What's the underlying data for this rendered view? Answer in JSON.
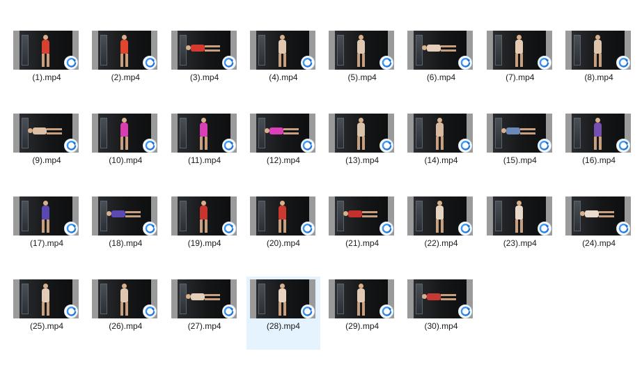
{
  "window": {
    "view": "large-icons",
    "selected_index": 27
  },
  "accent_color": "#e5f3ff",
  "files": [
    {
      "name": "(1).mp4",
      "pose": "standing",
      "suit": "#d8412f",
      "icon": "video-file-icon"
    },
    {
      "name": "(2).mp4",
      "pose": "standing",
      "suit": "#e0452e",
      "icon": "video-file-icon"
    },
    {
      "name": "(3).mp4",
      "pose": "lying",
      "suit": "#d63a2f",
      "icon": "video-file-icon"
    },
    {
      "name": "(4).mp4",
      "pose": "standing",
      "suit": "#e2c7b0",
      "icon": "video-file-icon"
    },
    {
      "name": "(5).mp4",
      "pose": "standing",
      "suit": "#e0c7b2",
      "icon": "video-file-icon"
    },
    {
      "name": "(6).mp4",
      "pose": "lying",
      "suit": "#e6d0bd",
      "icon": "video-file-icon"
    },
    {
      "name": "(7).mp4",
      "pose": "standing",
      "suit": "#e4cbb4",
      "icon": "video-file-icon"
    },
    {
      "name": "(8).mp4",
      "pose": "standing",
      "suit": "#dfc4ad",
      "icon": "video-file-icon"
    },
    {
      "name": "(9).mp4",
      "pose": "lying",
      "suit": "#dbc0a5",
      "icon": "video-file-icon"
    },
    {
      "name": "(10).mp4",
      "pose": "standing",
      "suit": "#d83db2",
      "icon": "video-file-icon"
    },
    {
      "name": "(11).mp4",
      "pose": "standing",
      "suit": "#da3fb5",
      "icon": "video-file-icon"
    },
    {
      "name": "(12).mp4",
      "pose": "lying",
      "suit": "#dc40b8",
      "icon": "video-file-icon"
    },
    {
      "name": "(13).mp4",
      "pose": "standing",
      "suit": "#d9c2aa",
      "icon": "video-file-icon"
    },
    {
      "name": "(14).mp4",
      "pose": "standing",
      "suit": "#d7b9a0",
      "icon": "video-file-icon"
    },
    {
      "name": "(15).mp4",
      "pose": "lying",
      "suit": "#6a88b8",
      "icon": "video-file-icon"
    },
    {
      "name": "(16).mp4",
      "pose": "standing",
      "suit": "#7650b0",
      "icon": "video-file-icon"
    },
    {
      "name": "(17).mp4",
      "pose": "standing",
      "suit": "#5a47b0",
      "icon": "video-file-icon"
    },
    {
      "name": "(18).mp4",
      "pose": "lying",
      "suit": "#5c49b2",
      "icon": "video-file-icon"
    },
    {
      "name": "(19).mp4",
      "pose": "standing",
      "suit": "#c9352e",
      "icon": "video-file-icon"
    },
    {
      "name": "(20).mp4",
      "pose": "standing",
      "suit": "#cc3a2f",
      "icon": "video-file-icon"
    },
    {
      "name": "(21).mp4",
      "pose": "lying",
      "suit": "#c4302b",
      "icon": "video-file-icon"
    },
    {
      "name": "(22).mp4",
      "pose": "standing",
      "suit": "#e6d4c3",
      "icon": "video-file-icon"
    },
    {
      "name": "(23).mp4",
      "pose": "standing",
      "suit": "#e9d9ca",
      "icon": "video-file-icon"
    },
    {
      "name": "(24).mp4",
      "pose": "lying",
      "suit": "#eadbcd",
      "icon": "video-file-icon"
    },
    {
      "name": "(25).mp4",
      "pose": "standing",
      "suit": "#e2ccb8",
      "icon": "video-file-icon"
    },
    {
      "name": "(26).mp4",
      "pose": "standing",
      "suit": "#dfc6b0",
      "icon": "video-file-icon"
    },
    {
      "name": "(27).mp4",
      "pose": "lying",
      "suit": "#e4cfbb",
      "icon": "video-file-icon"
    },
    {
      "name": "(28).mp4",
      "pose": "standing",
      "suit": "#e8d4c1",
      "icon": "video-file-icon"
    },
    {
      "name": "(29).mp4",
      "pose": "standing",
      "suit": "#e1c9b3",
      "icon": "video-file-icon"
    },
    {
      "name": "(30).mp4",
      "pose": "lying",
      "suit": "#c53a34",
      "icon": "video-file-icon"
    }
  ]
}
